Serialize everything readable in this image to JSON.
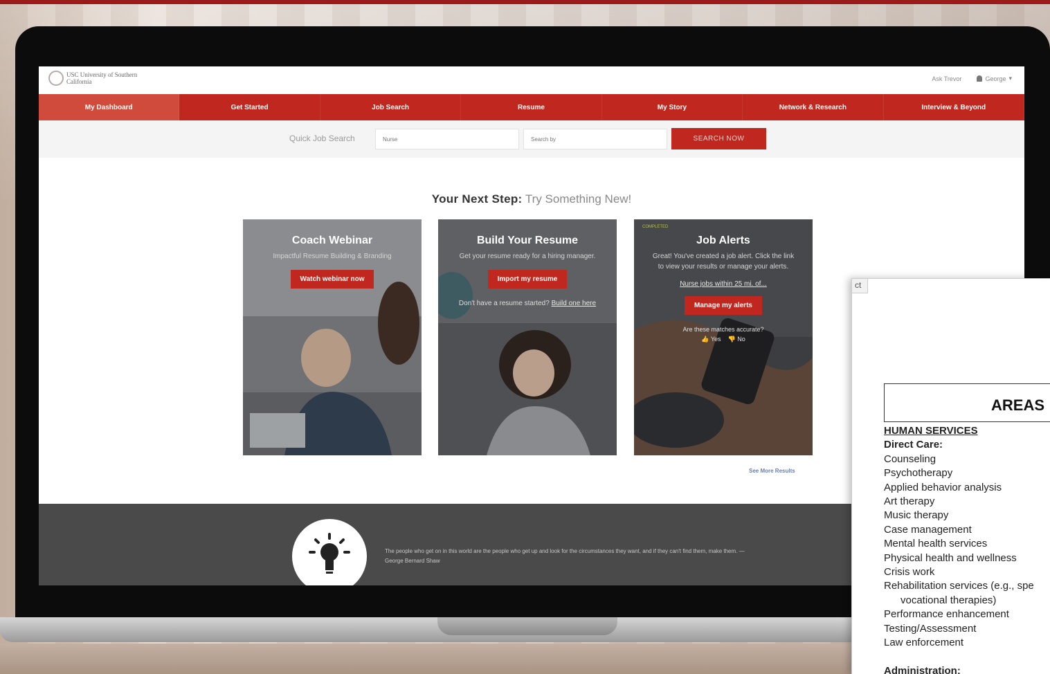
{
  "colors": {
    "brand_red": "#c0281f",
    "nav_active": "#d04b3c",
    "footer_band": "#4a4a4a",
    "link_blue": "#6a7fb0"
  },
  "header": {
    "logo_text": "USC University of Southern California",
    "right_link": "Ask Trevor",
    "user_label": "George"
  },
  "nav": {
    "items": [
      {
        "label": "My Dashboard"
      },
      {
        "label": "Get Started"
      },
      {
        "label": "Job Search"
      },
      {
        "label": "Resume"
      },
      {
        "label": "My Story"
      },
      {
        "label": "Network & Research"
      },
      {
        "label": "Interview & Beyond"
      }
    ]
  },
  "quick_search": {
    "label": "Quick Job Search",
    "keyword_placeholder": "Nurse",
    "location_placeholder": "Search by",
    "button_label": "SEARCH NOW"
  },
  "next_step": {
    "prefix": "Your Next Step:",
    "text": "Try Something New!"
  },
  "cards": [
    {
      "title": "Coach Webinar",
      "subtitle": "Impactful Resume Building & Branding",
      "button": "Watch webinar now"
    },
    {
      "title": "Build Your Resume",
      "subtitle": "Get your resume ready for a hiring manager.",
      "button": "Import my resume",
      "note": "Don't have a resume started?",
      "note_link": "Build one here"
    },
    {
      "tag": "COMPLETED",
      "title": "Job Alerts",
      "subtitle": "Great! You've created a job alert. Click the link to view your results or manage your alerts.",
      "link": "Nurse jobs within 25 mi. of...",
      "button": "Manage my alerts",
      "question": "Are these matches accurate?",
      "yes": "Yes",
      "no": "No"
    }
  ],
  "see_more": "See More Results",
  "footer": {
    "quote": "The people who get on in this world are the people who get up and look for the circumstances they want, and if they can't find them, make them. — George Bernard Shaw"
  },
  "document": {
    "tab_label": "ct",
    "heading": "AREAS",
    "section": "HUMAN SERVICES",
    "subhead_1": "Direct Care:",
    "items": [
      "Counseling",
      "Psychotherapy",
      "Applied behavior analysis",
      "Art therapy",
      "Music therapy",
      "Case management",
      "Mental health services",
      "Physical health and wellness",
      "Crisis work",
      "Rehabilitation services (e.g., spe",
      "vocational therapies)",
      "Performance enhancement",
      "Testing/Assessment",
      "Law enforcement"
    ],
    "subhead_2": "Administration:"
  }
}
